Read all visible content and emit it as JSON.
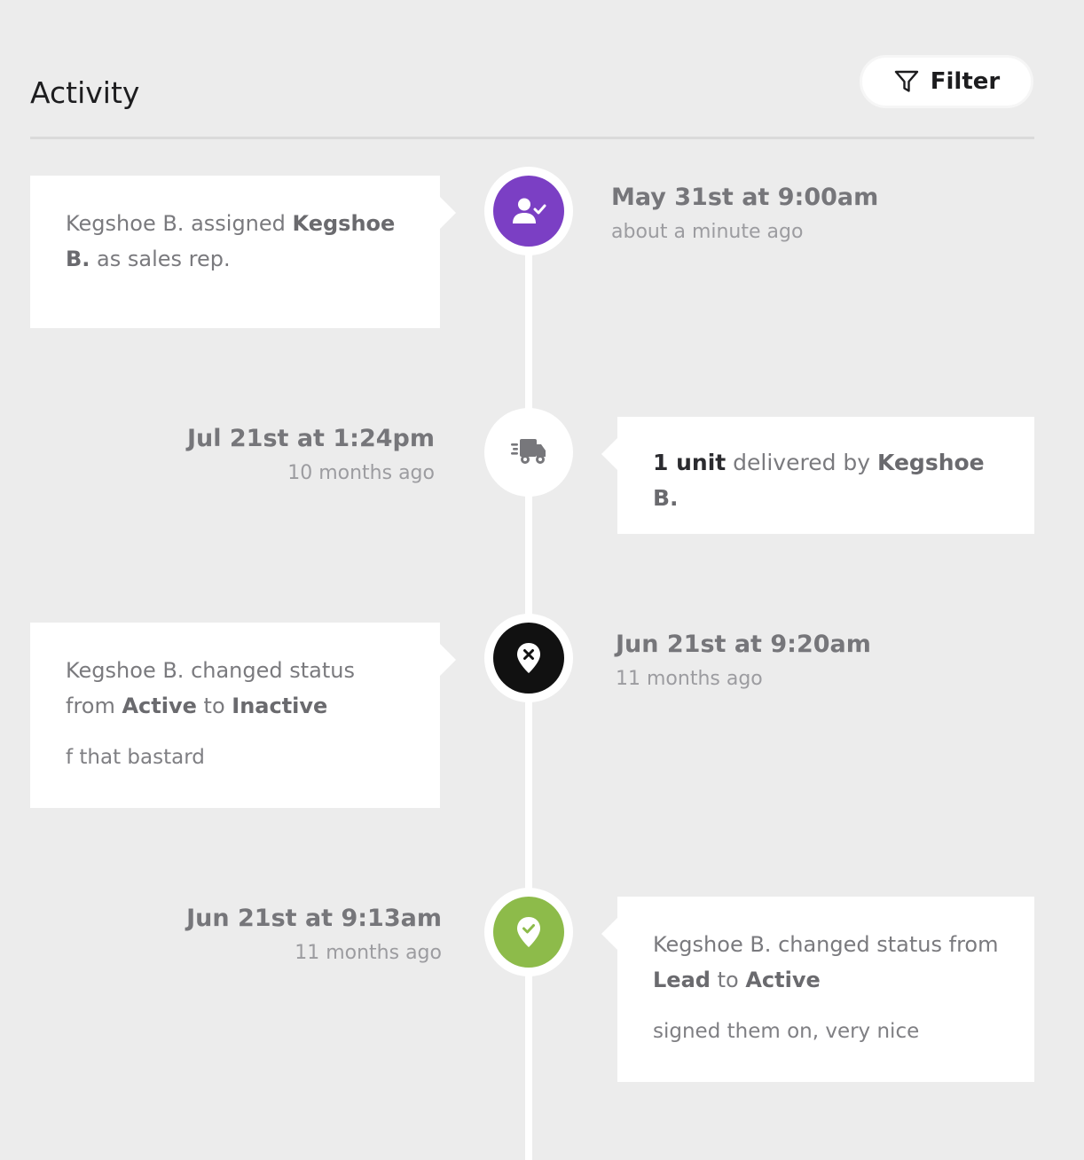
{
  "header": {
    "title": "Activity",
    "filter_label": "Filter"
  },
  "events": [
    {
      "icon": "user-check-icon",
      "icon_color": "#7b3fc4",
      "date": "May 31st at 9:00am",
      "ago": "about a minute ago",
      "text_parts": [
        "Kegshoe B.",
        " assigned ",
        "Kegshoe B.",
        " as sales rep."
      ]
    },
    {
      "icon": "delivery-truck-icon",
      "icon_color": "#ffffff",
      "date": "Jul 21st at 1:24pm",
      "ago": "10 months ago",
      "text_parts": [
        "1 unit",
        " delivered by ",
        "Kegshoe B."
      ]
    },
    {
      "icon": "location-x-icon",
      "icon_color": "#111111",
      "date": "Jun 21st at 9:20am",
      "ago": "11 months ago",
      "text_parts": [
        "Kegshoe B.",
        " changed status from ",
        "Active",
        " to ",
        "Inactive"
      ],
      "note": "f that bastard"
    },
    {
      "icon": "location-check-icon",
      "icon_color": "#8dbb4a",
      "date": "Jun 21st at 9:13am",
      "ago": "11 months ago",
      "text_parts": [
        "Kegshoe B.",
        " changed status from ",
        "Lead",
        " to ",
        "Active"
      ],
      "note": "signed them on, very nice"
    }
  ]
}
